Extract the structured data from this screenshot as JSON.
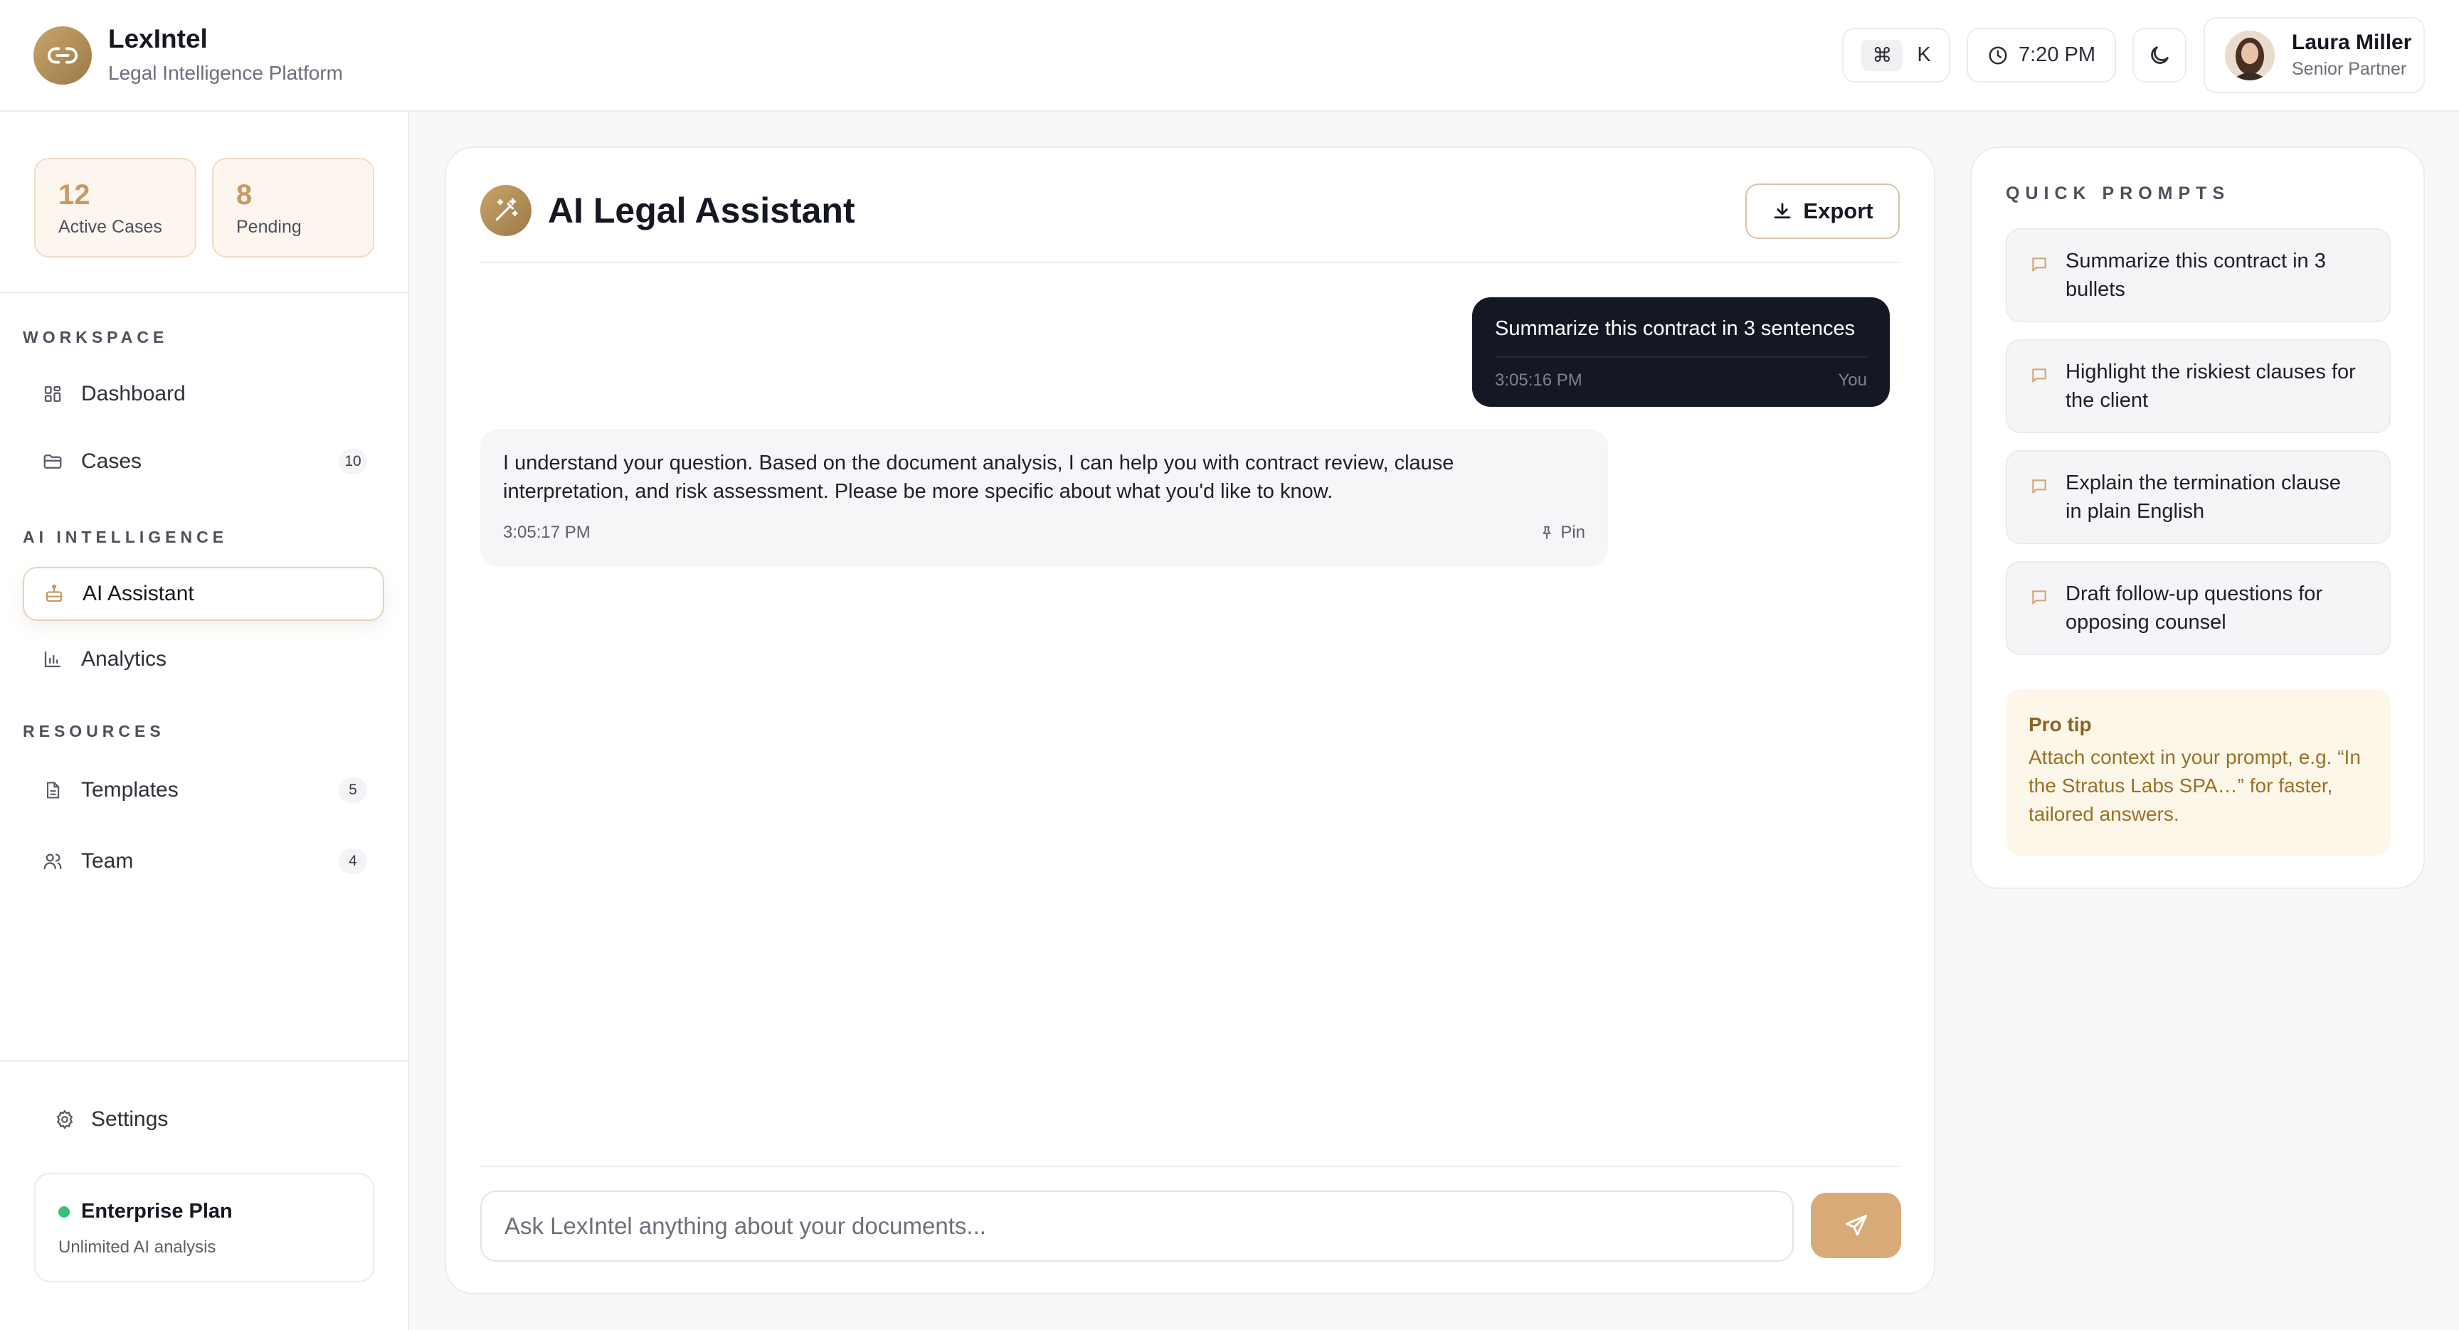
{
  "app": {
    "name": "LexIntel",
    "tagline": "Legal Intelligence Platform"
  },
  "header": {
    "command_key": "⌘",
    "command_letter": "K",
    "time": "7:20 PM",
    "user": {
      "name": "Laura Miller",
      "role": "Senior Partner"
    }
  },
  "sidebar": {
    "stats": [
      {
        "value": "12",
        "label": "Active Cases"
      },
      {
        "value": "8",
        "label": "Pending"
      }
    ],
    "sections": {
      "workspace": "WORKSPACE",
      "ai": "AI INTELLIGENCE",
      "resources": "RESOURCES"
    },
    "items": {
      "dashboard": {
        "label": "Dashboard"
      },
      "cases": {
        "label": "Cases",
        "badge": "10"
      },
      "ai_assistant": {
        "label": "AI Assistant"
      },
      "analytics": {
        "label": "Analytics"
      },
      "templates": {
        "label": "Templates",
        "badge": "5"
      },
      "team": {
        "label": "Team",
        "badge": "4"
      }
    },
    "settings_label": "Settings",
    "plan": {
      "title": "Enterprise Plan",
      "subtitle": "Unlimited AI analysis"
    }
  },
  "chat": {
    "title": "AI Legal Assistant",
    "export_label": "Export",
    "messages": [
      {
        "role": "user",
        "text": "Summarize this contract in 3 sentences",
        "time": "3:05:16 PM",
        "author": "You"
      },
      {
        "role": "assistant",
        "text": "I understand your question. Based on the document analysis, I can help you with contract review, clause interpretation, and risk assessment. Please be more specific about what you'd like to know.",
        "time": "3:05:17 PM",
        "pin_label": "Pin"
      }
    ],
    "input_placeholder": "Ask LexIntel anything about your documents..."
  },
  "quick_prompts": {
    "title": "QUICK PROMPTS",
    "items": [
      "Summarize this contract in 3 bullets",
      "Highlight the riskiest clauses for the client",
      "Explain the termination clause in plain English",
      "Draft follow-up questions for opposing counsel"
    ],
    "tip": {
      "title": "Pro tip",
      "text": "Attach context in your prompt, e.g. “In the Stratus Labs SPA…” for faster, tailored answers."
    }
  },
  "colors": {
    "accent": "#c9a46a",
    "accent_dark": "#9a7a48",
    "send_button": "#d8aa78",
    "user_bubble": "#141824",
    "status_online": "#34c27a",
    "tip_text": "#9a7126"
  },
  "icons": {
    "logo": "link-icon",
    "time": "clock-icon",
    "theme": "moon-icon",
    "dashboard": "grid-icon",
    "cases": "folder-icon",
    "ai_assistant": "bot-icon",
    "analytics": "bar-chart-icon",
    "templates": "document-icon",
    "team": "users-icon",
    "settings": "gear-icon",
    "chat": "magic-wand-icon",
    "export": "download-icon",
    "pin": "pin-icon",
    "send": "send-icon",
    "prompt": "message-icon"
  }
}
